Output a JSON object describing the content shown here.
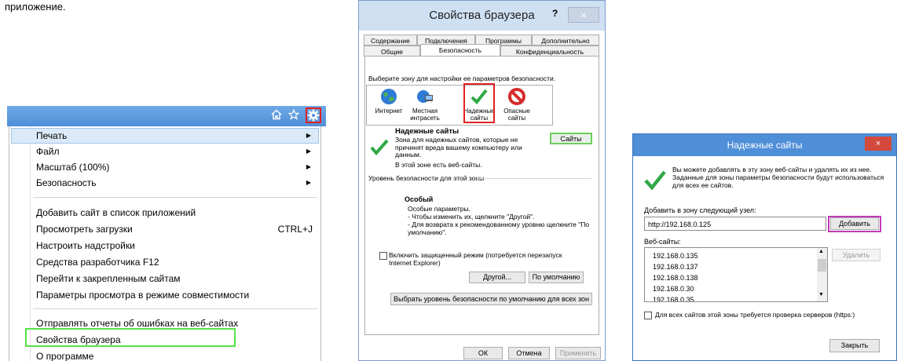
{
  "caption": "приложение.",
  "ie_menu": {
    "toolbar_icons": [
      "home-icon",
      "star-icon",
      "gear-icon"
    ],
    "items": [
      {
        "label": "Печать",
        "submenu": true,
        "shortcut": ""
      },
      {
        "label": "Файл",
        "submenu": true,
        "shortcut": ""
      },
      {
        "label": "Масштаб (100%)",
        "submenu": true,
        "shortcut": ""
      },
      {
        "label": "Безопасность",
        "submenu": true,
        "shortcut": ""
      },
      {
        "label": "Добавить сайт в список приложений",
        "submenu": false,
        "shortcut": ""
      },
      {
        "label": "Просмотреть загрузки",
        "submenu": false,
        "shortcut": "CTRL+J"
      },
      {
        "label": "Настроить надстройки",
        "submenu": false,
        "shortcut": ""
      },
      {
        "label": "Средства разработчика F12",
        "submenu": false,
        "shortcut": ""
      },
      {
        "label": "Перейти к закрепленным сайтам",
        "submenu": false,
        "shortcut": ""
      },
      {
        "label": "Параметры просмотра в режиме совместимости",
        "submenu": false,
        "shortcut": ""
      },
      {
        "label": "Отправлять отчеты об ошибках на веб-сайтах",
        "submenu": false,
        "shortcut": ""
      },
      {
        "label": "Свойства браузера",
        "submenu": false,
        "shortcut": ""
      },
      {
        "label": "О программе",
        "submenu": false,
        "shortcut": ""
      }
    ]
  },
  "browser_props": {
    "title": "Свойства браузера",
    "help": "?",
    "close": "×",
    "tabs_row1": [
      "Содержание",
      "Подключения",
      "Программы",
      "Дополнительно"
    ],
    "tabs_row2": [
      "Общие",
      "Безопасность",
      "Конфиденциальность"
    ],
    "active_tab": "Безопасность",
    "select_zone": "Выберите зону для настройки ее параметров безопасности.",
    "zones": [
      {
        "label": "Интернет",
        "icon": "globe-icon"
      },
      {
        "label": "Местная интрасеть",
        "icon": "intranet-icon"
      },
      {
        "label": "Надежные сайты",
        "icon": "checkmark-icon"
      },
      {
        "label": "Опасные сайты",
        "icon": "forbidden-icon"
      }
    ],
    "zone_heading": "Надежные сайты",
    "zone_desc": "Зона для надежных сайтов, которые не причинят вреда вашему компьютеру или данным.",
    "zone_has_sites": "В этой зоне есть веб-сайты.",
    "sites_button": "Сайты",
    "level_group": "Уровень безопасности для этой зоны",
    "level_name": "Особый",
    "level_line1": "Особые параметры.",
    "level_line2": "- Чтобы изменить их, щелкните \"Другой\".",
    "level_line3": "- Для возврата к рекомендованному уровню щелкните \"По умолчанию\".",
    "protected_mode": "Включить защищенный режим (потребуется перезапуск Internet Explorer)",
    "other_button": "Другой...",
    "default_button": "По умолчанию",
    "default_all_button": "Выбрать уровень безопасности по умолчанию для всех зон",
    "ok": "ОК",
    "cancel": "Отмена",
    "apply": "Применить"
  },
  "trusted_sites": {
    "title": "Надежные сайты",
    "close": "×",
    "info": "Вы можете добавлять в эту зону веб-сайты и удалять их из нее. Заданные для зоны параметры безопасности будут использоваться для всех ее сайтов.",
    "add_label": "Добавить в зону следующий узел:",
    "add_value": "http://192.168.0.125",
    "add_button": "Добавить",
    "websites_label": "Веб-сайты:",
    "sites": [
      "192.168.0.135",
      "192.168.0.137",
      "192.168.0.138",
      "192.168.0.30",
      "192.168.0.35"
    ],
    "remove_button": "Удалить",
    "require_https": "Для всех сайтов этой зоны требуется проверка серверов (https:)",
    "close_button": "Закрыть"
  }
}
